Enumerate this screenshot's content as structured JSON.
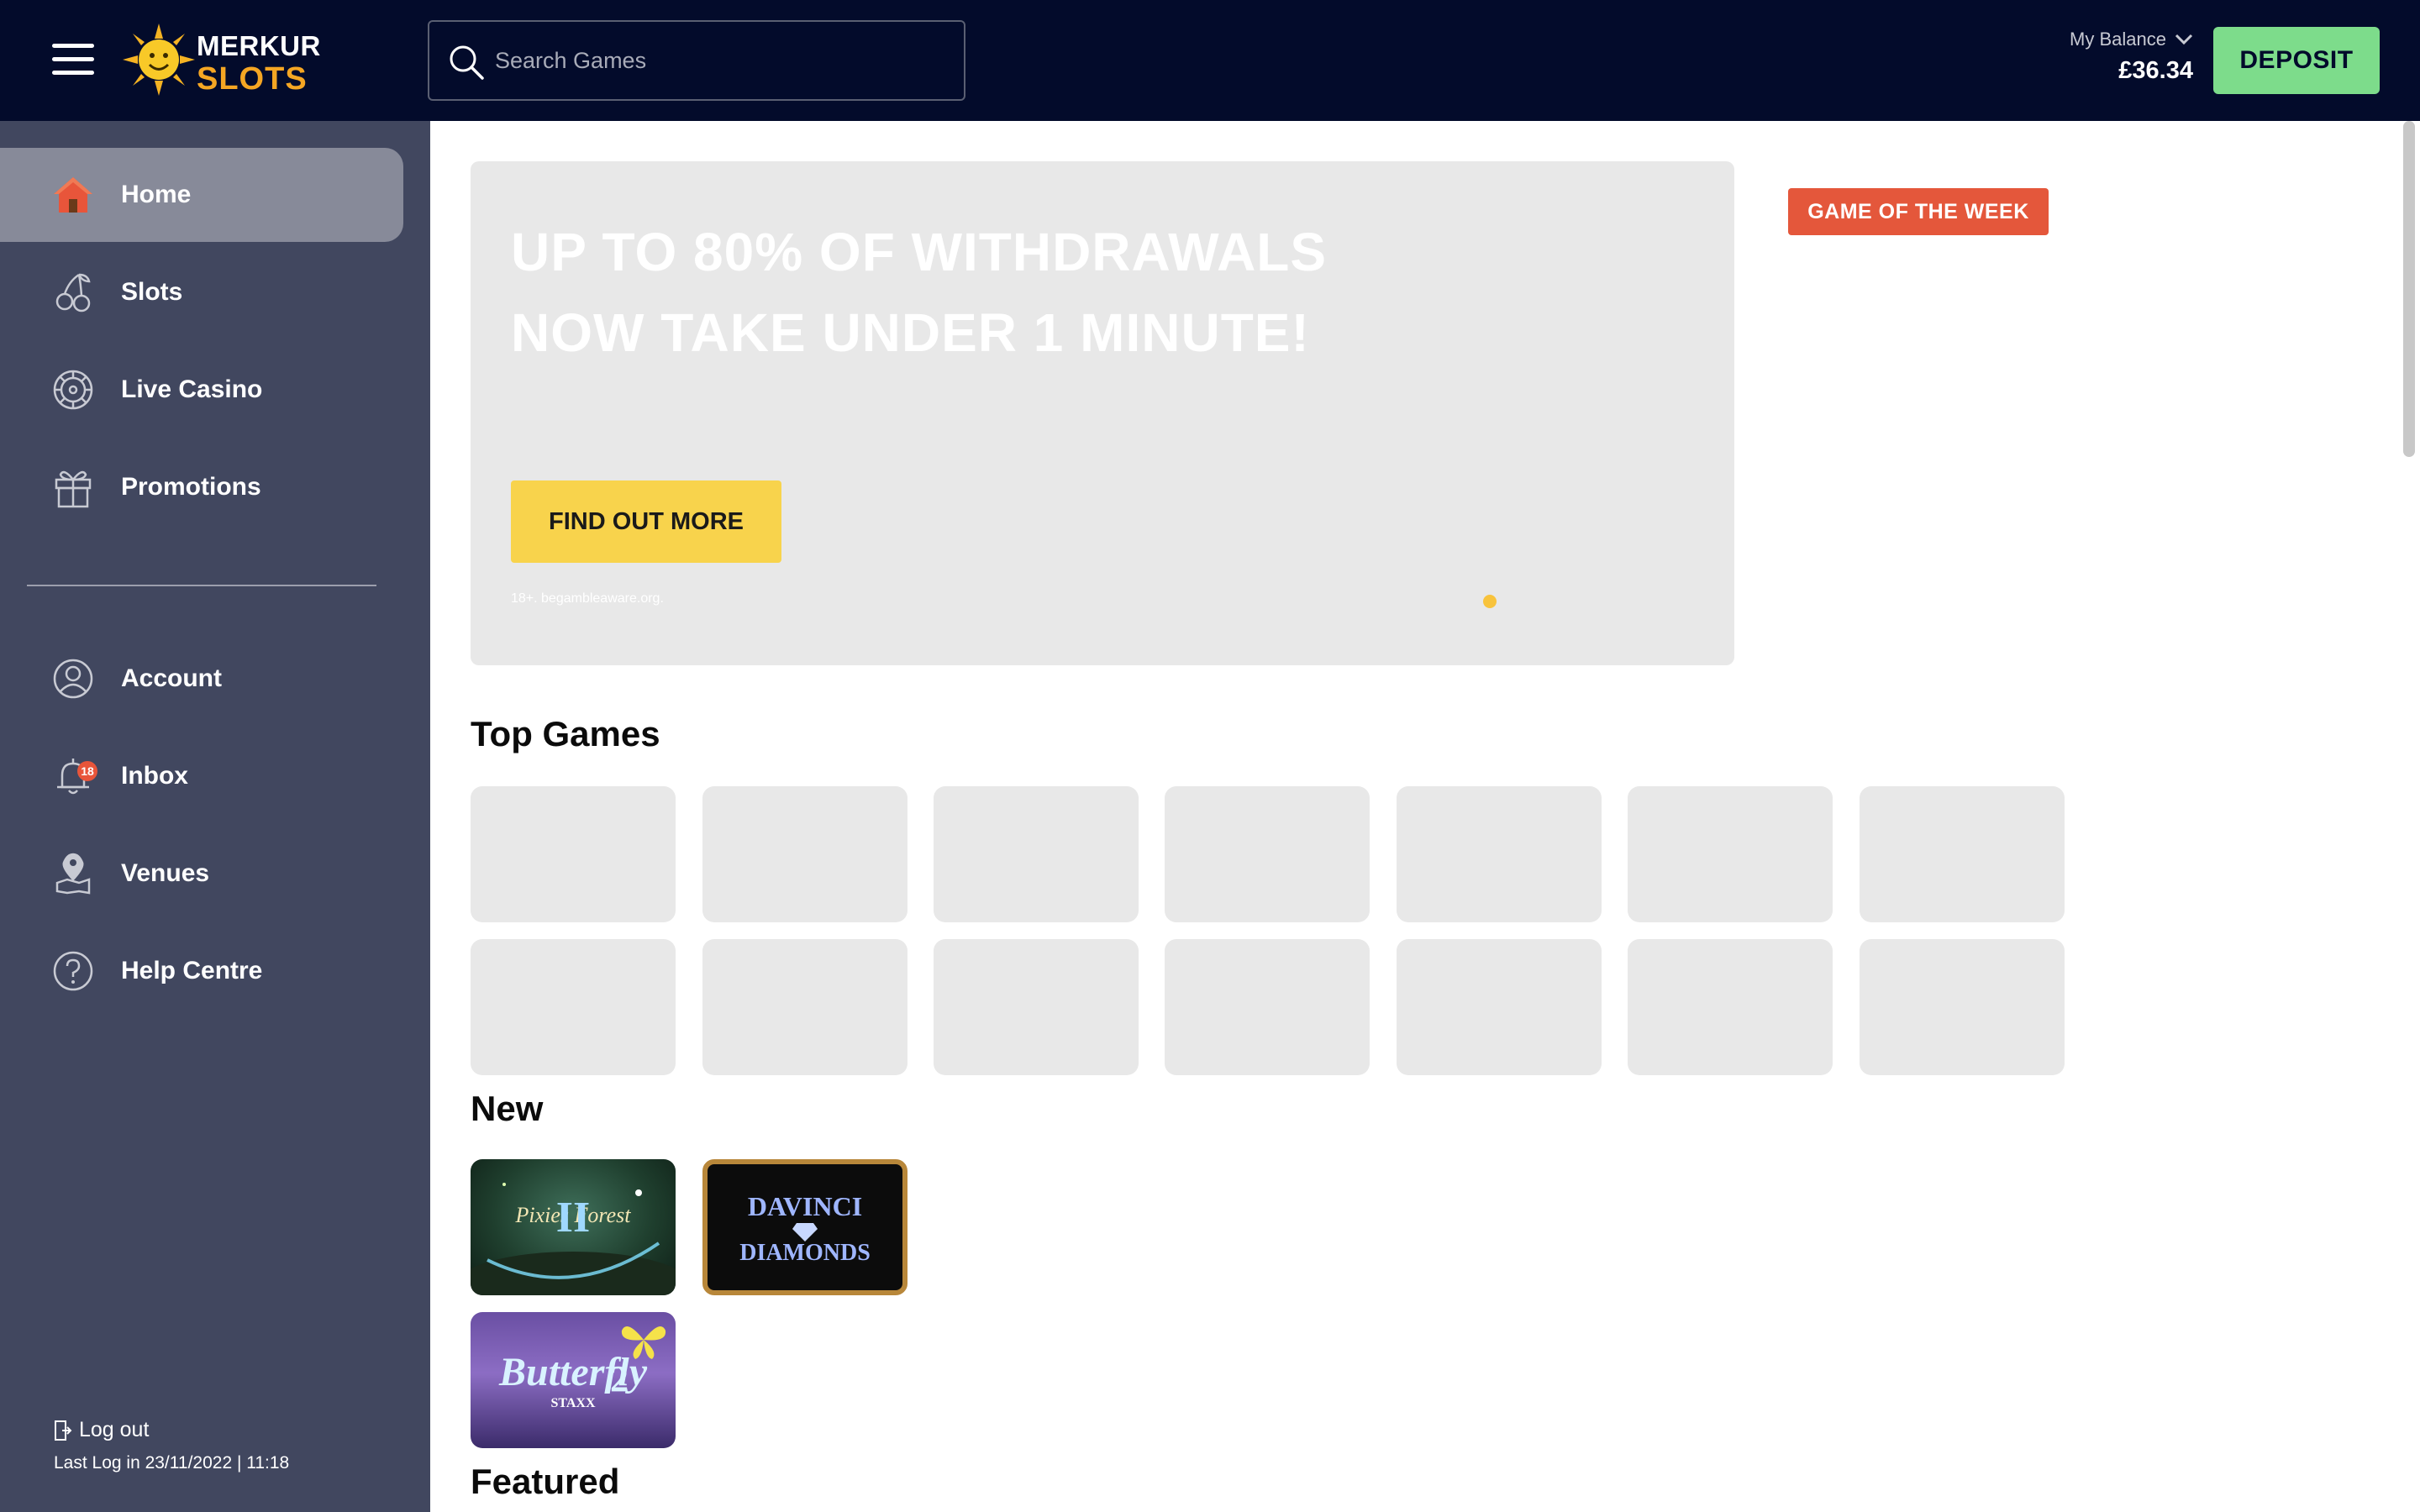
{
  "header": {
    "logo_top": "MERKUR",
    "logo_bottom": "SLOTS",
    "search_placeholder": "Search Games",
    "balance_label": "My Balance",
    "balance_value": "£36.34",
    "deposit_label": "DEPOSIT"
  },
  "sidebar": {
    "items": [
      {
        "label": "Home",
        "icon": "home-icon",
        "active": true
      },
      {
        "label": "Slots",
        "icon": "cherries-icon"
      },
      {
        "label": "Live Casino",
        "icon": "roulette-wheel-icon"
      },
      {
        "label": "Promotions",
        "icon": "gift-icon"
      }
    ],
    "account_items": [
      {
        "label": "Account",
        "icon": "user-circle-icon"
      },
      {
        "label": "Inbox",
        "icon": "bell-icon",
        "badge": "18"
      },
      {
        "label": "Venues",
        "icon": "map-pin-icon"
      },
      {
        "label": "Help Centre",
        "icon": "question-circle-icon"
      }
    ],
    "logout_label": "Log out",
    "last_log": "Last Log in 23/11/2022 | 11:18"
  },
  "banner": {
    "title": "UP TO 80% OF WITHDRAWALS NOW TAKE UNDER 1 MINUTE!",
    "button_label": "FIND OUT MORE",
    "disclaimer": "18+. begambleaware.org."
  },
  "game_of_week_label": "GAME OF THE WEEK",
  "sections": {
    "top_games": "Top Games",
    "new": "New",
    "featured": "Featured"
  },
  "new_games": [
    {
      "name": "Pixies of the Forest II",
      "title_text": "Pixies Forest",
      "numeral": "II"
    },
    {
      "name": "Da Vinci Diamonds",
      "title_text": "DAVINCI",
      "subtitle_text": "DIAMONDS"
    },
    {
      "name": "Butterfly Staxx 2",
      "title_text": "Butterfly",
      "subtitle_text": "STAXX",
      "numeral": "2"
    }
  ],
  "colors": {
    "header_bg": "#030b2b",
    "sidebar_bg": "#41475f",
    "deposit_green": "#7ddc8b",
    "cta_yellow": "#f8d34c",
    "badge_red": "#e4573b"
  }
}
